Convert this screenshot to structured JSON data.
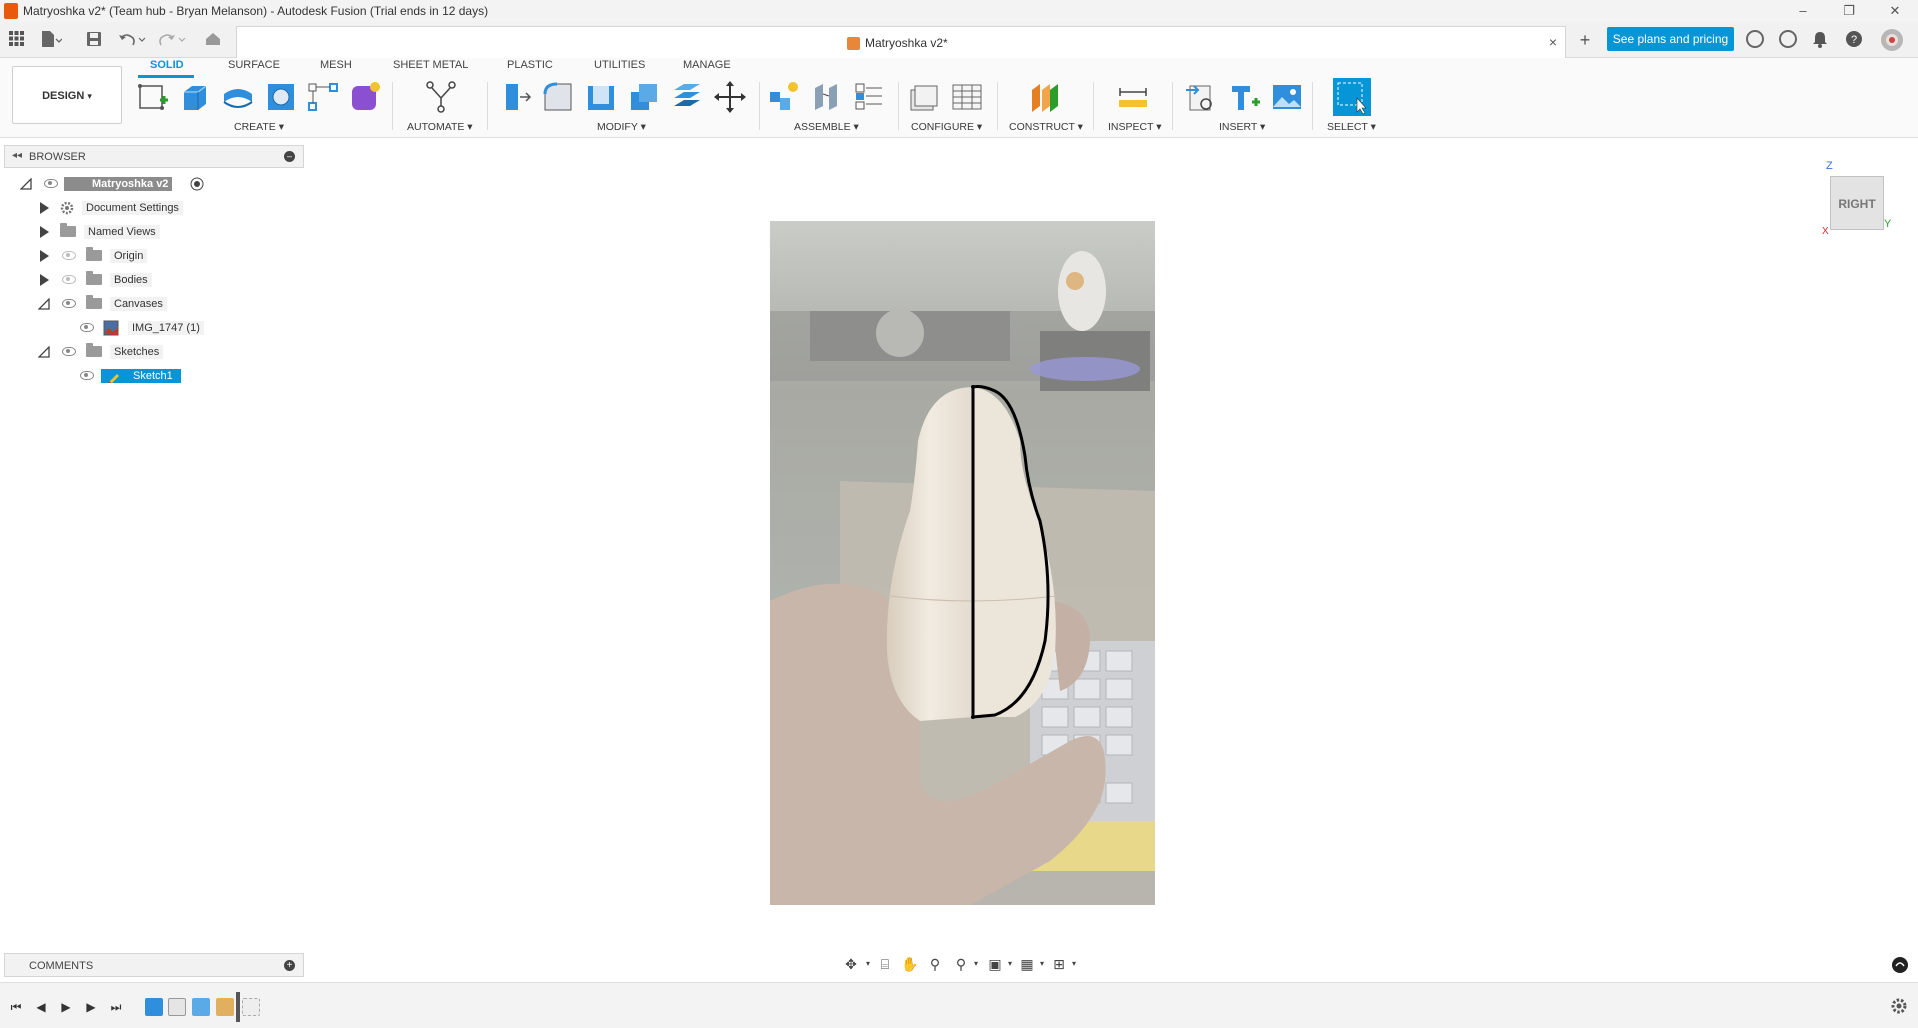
{
  "window": {
    "title": "Matryoshka v2* (Team hub - Bryan Melanson) - Autodesk Fusion (Trial ends in 12 days)",
    "minimize": "–",
    "restore": "❐",
    "close": "✕"
  },
  "tabs": {
    "document_title": "Matryoshka v2*",
    "close": "×",
    "new_tab": "+",
    "plans_button": "See plans and pricing"
  },
  "ribbon": {
    "workspace": "DESIGN",
    "tabs": [
      "SOLID",
      "SURFACE",
      "MESH",
      "SHEET METAL",
      "PLASTIC",
      "UTILITIES",
      "MANAGE"
    ],
    "groups": [
      "CREATE",
      "AUTOMATE",
      "MODIFY",
      "ASSEMBLE",
      "CONFIGURE",
      "CONSTRUCT",
      "INSPECT",
      "INSERT",
      "SELECT"
    ]
  },
  "browser": {
    "title": "BROWSER",
    "items": [
      {
        "label": "Matryoshka v2"
      },
      {
        "label": "Document Settings"
      },
      {
        "label": "Named Views"
      },
      {
        "label": "Origin"
      },
      {
        "label": "Bodies"
      },
      {
        "label": "Canvases"
      },
      {
        "label": "IMG_1747 (1)"
      },
      {
        "label": "Sketches"
      },
      {
        "label": "Sketch1"
      }
    ]
  },
  "viewcube": {
    "face": "RIGHT",
    "axis_z": "Z",
    "axis_y": "Y",
    "axis_x": "X"
  },
  "comments": {
    "title": "COMMENTS"
  },
  "colors": {
    "accent": "#0696d7",
    "brand": "#e8590c"
  }
}
